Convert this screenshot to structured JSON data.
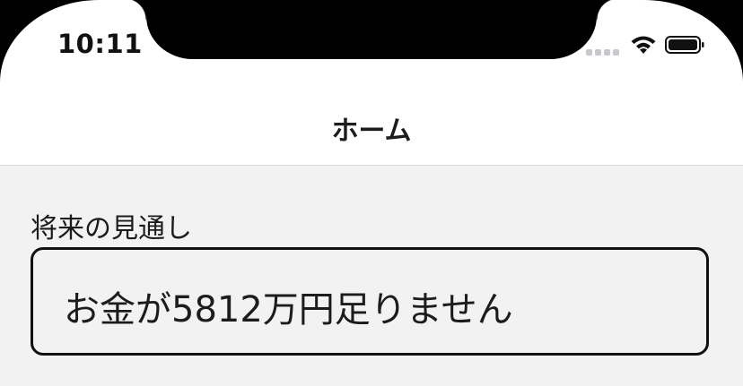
{
  "status_bar": {
    "time": "10:11",
    "icons": {
      "signal": "cellular-signal-icon",
      "wifi": "wifi-icon",
      "battery": "battery-icon"
    }
  },
  "nav_bar": {
    "title": "ホーム"
  },
  "forecast": {
    "label": "将来の見通し",
    "message": "お金が5812万円足りません"
  },
  "colors": {
    "background": "#f2f2f2",
    "text": "#1c1c1e",
    "border": "#111111"
  }
}
